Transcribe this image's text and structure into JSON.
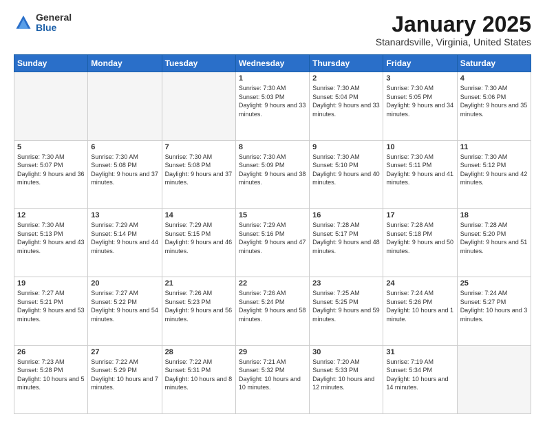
{
  "logo": {
    "general": "General",
    "blue": "Blue"
  },
  "header": {
    "month": "January 2025",
    "location": "Stanardsville, Virginia, United States"
  },
  "weekdays": [
    "Sunday",
    "Monday",
    "Tuesday",
    "Wednesday",
    "Thursday",
    "Friday",
    "Saturday"
  ],
  "weeks": [
    [
      {
        "day": "",
        "info": ""
      },
      {
        "day": "",
        "info": ""
      },
      {
        "day": "",
        "info": ""
      },
      {
        "day": "1",
        "info": "Sunrise: 7:30 AM\nSunset: 5:03 PM\nDaylight: 9 hours and 33 minutes."
      },
      {
        "day": "2",
        "info": "Sunrise: 7:30 AM\nSunset: 5:04 PM\nDaylight: 9 hours and 33 minutes."
      },
      {
        "day": "3",
        "info": "Sunrise: 7:30 AM\nSunset: 5:05 PM\nDaylight: 9 hours and 34 minutes."
      },
      {
        "day": "4",
        "info": "Sunrise: 7:30 AM\nSunset: 5:06 PM\nDaylight: 9 hours and 35 minutes."
      }
    ],
    [
      {
        "day": "5",
        "info": "Sunrise: 7:30 AM\nSunset: 5:07 PM\nDaylight: 9 hours and 36 minutes."
      },
      {
        "day": "6",
        "info": "Sunrise: 7:30 AM\nSunset: 5:08 PM\nDaylight: 9 hours and 37 minutes."
      },
      {
        "day": "7",
        "info": "Sunrise: 7:30 AM\nSunset: 5:08 PM\nDaylight: 9 hours and 37 minutes."
      },
      {
        "day": "8",
        "info": "Sunrise: 7:30 AM\nSunset: 5:09 PM\nDaylight: 9 hours and 38 minutes."
      },
      {
        "day": "9",
        "info": "Sunrise: 7:30 AM\nSunset: 5:10 PM\nDaylight: 9 hours and 40 minutes."
      },
      {
        "day": "10",
        "info": "Sunrise: 7:30 AM\nSunset: 5:11 PM\nDaylight: 9 hours and 41 minutes."
      },
      {
        "day": "11",
        "info": "Sunrise: 7:30 AM\nSunset: 5:12 PM\nDaylight: 9 hours and 42 minutes."
      }
    ],
    [
      {
        "day": "12",
        "info": "Sunrise: 7:30 AM\nSunset: 5:13 PM\nDaylight: 9 hours and 43 minutes."
      },
      {
        "day": "13",
        "info": "Sunrise: 7:29 AM\nSunset: 5:14 PM\nDaylight: 9 hours and 44 minutes."
      },
      {
        "day": "14",
        "info": "Sunrise: 7:29 AM\nSunset: 5:15 PM\nDaylight: 9 hours and 46 minutes."
      },
      {
        "day": "15",
        "info": "Sunrise: 7:29 AM\nSunset: 5:16 PM\nDaylight: 9 hours and 47 minutes."
      },
      {
        "day": "16",
        "info": "Sunrise: 7:28 AM\nSunset: 5:17 PM\nDaylight: 9 hours and 48 minutes."
      },
      {
        "day": "17",
        "info": "Sunrise: 7:28 AM\nSunset: 5:18 PM\nDaylight: 9 hours and 50 minutes."
      },
      {
        "day": "18",
        "info": "Sunrise: 7:28 AM\nSunset: 5:20 PM\nDaylight: 9 hours and 51 minutes."
      }
    ],
    [
      {
        "day": "19",
        "info": "Sunrise: 7:27 AM\nSunset: 5:21 PM\nDaylight: 9 hours and 53 minutes."
      },
      {
        "day": "20",
        "info": "Sunrise: 7:27 AM\nSunset: 5:22 PM\nDaylight: 9 hours and 54 minutes."
      },
      {
        "day": "21",
        "info": "Sunrise: 7:26 AM\nSunset: 5:23 PM\nDaylight: 9 hours and 56 minutes."
      },
      {
        "day": "22",
        "info": "Sunrise: 7:26 AM\nSunset: 5:24 PM\nDaylight: 9 hours and 58 minutes."
      },
      {
        "day": "23",
        "info": "Sunrise: 7:25 AM\nSunset: 5:25 PM\nDaylight: 9 hours and 59 minutes."
      },
      {
        "day": "24",
        "info": "Sunrise: 7:24 AM\nSunset: 5:26 PM\nDaylight: 10 hours and 1 minute."
      },
      {
        "day": "25",
        "info": "Sunrise: 7:24 AM\nSunset: 5:27 PM\nDaylight: 10 hours and 3 minutes."
      }
    ],
    [
      {
        "day": "26",
        "info": "Sunrise: 7:23 AM\nSunset: 5:28 PM\nDaylight: 10 hours and 5 minutes."
      },
      {
        "day": "27",
        "info": "Sunrise: 7:22 AM\nSunset: 5:29 PM\nDaylight: 10 hours and 7 minutes."
      },
      {
        "day": "28",
        "info": "Sunrise: 7:22 AM\nSunset: 5:31 PM\nDaylight: 10 hours and 8 minutes."
      },
      {
        "day": "29",
        "info": "Sunrise: 7:21 AM\nSunset: 5:32 PM\nDaylight: 10 hours and 10 minutes."
      },
      {
        "day": "30",
        "info": "Sunrise: 7:20 AM\nSunset: 5:33 PM\nDaylight: 10 hours and 12 minutes."
      },
      {
        "day": "31",
        "info": "Sunrise: 7:19 AM\nSunset: 5:34 PM\nDaylight: 10 hours and 14 minutes."
      },
      {
        "day": "",
        "info": ""
      }
    ]
  ]
}
